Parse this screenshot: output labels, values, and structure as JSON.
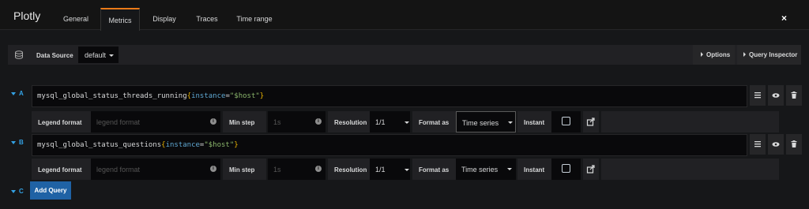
{
  "app_title": "Plotly",
  "tabs": [
    "General",
    "Metrics",
    "Display",
    "Traces",
    "Time range"
  ],
  "close_icon": "×",
  "datasource": {
    "label": "Data Source",
    "value": "default"
  },
  "toolbar": {
    "options": "Options",
    "inspector": "Query Inspector"
  },
  "queries": [
    {
      "ref": "A",
      "metric": "mysql_global_status_threads_running",
      "label_key": "instance",
      "label_value": "\"$host\"",
      "legend_label": "Legend format",
      "legend_placeholder": "legend format",
      "minstep_label": "Min step",
      "minstep_placeholder": "1s",
      "resolution_label": "Resolution",
      "resolution": "1/1",
      "format_label": "Format as",
      "format": "Time series",
      "instant_label": "Instant"
    },
    {
      "ref": "B",
      "metric": "mysql_global_status_questions",
      "label_key": "instance",
      "label_value": "\"$host\"",
      "legend_label": "Legend format",
      "legend_placeholder": "legend format",
      "minstep_label": "Min step",
      "minstep_placeholder": "1s",
      "resolution_label": "Resolution",
      "resolution": "1/1",
      "format_label": "Format as",
      "format": "Time series",
      "instant_label": "Instant"
    }
  ],
  "next_ref": "C",
  "add_query": "Add Query",
  "colors": {
    "accent": "#eb7b18",
    "link": "#33a2e5",
    "primary": "#1f62a5"
  }
}
